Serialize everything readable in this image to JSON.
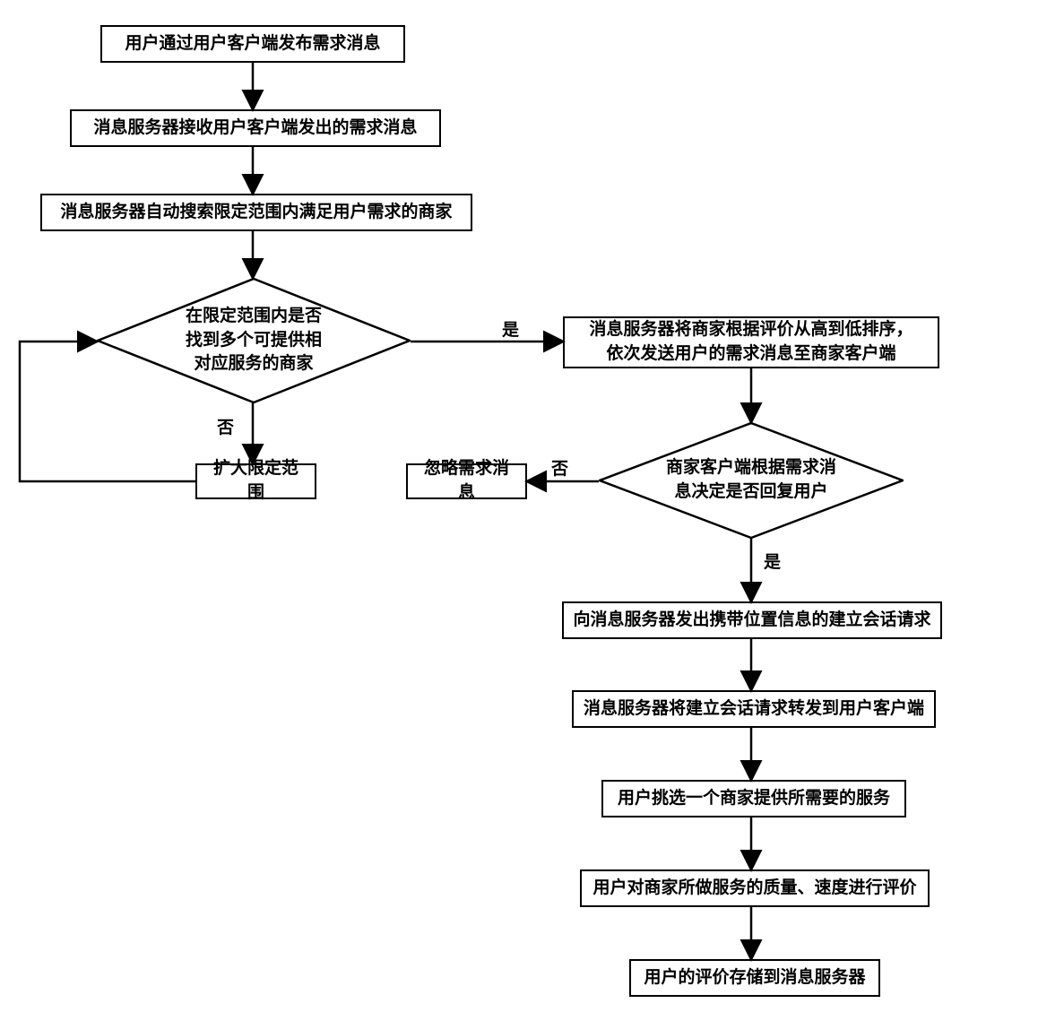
{
  "nodes": {
    "n1": "用户通过用户客户端发布需求消息",
    "n2": "消息服务器接收用户客户端发出的需求消息",
    "n3": "消息服务器自动搜索限定范围内满足用户需求的商家",
    "d1": "在限定范围内是否\n找到多个可提供相\n对应服务的商家",
    "n4": "扩大限定范围",
    "n5": "消息服务器将商家根据评价从高到低排序，\n依次发送用户的需求消息至商家客户端",
    "d2": "商家客户端根据需求消\n息决定是否回复用户",
    "n6": "忽略需求消息",
    "n7": "向消息服务器发出携带位置信息的建立会话请求",
    "n8": "消息服务器将建立会话请求转发到用户客户端",
    "n9": "用户挑选一个商家提供所需要的服务",
    "n10": "用户对商家所做服务的质量、速度进行评价",
    "n11": "用户的评价存储到消息服务器"
  },
  "labels": {
    "yes": "是",
    "no": "否"
  }
}
